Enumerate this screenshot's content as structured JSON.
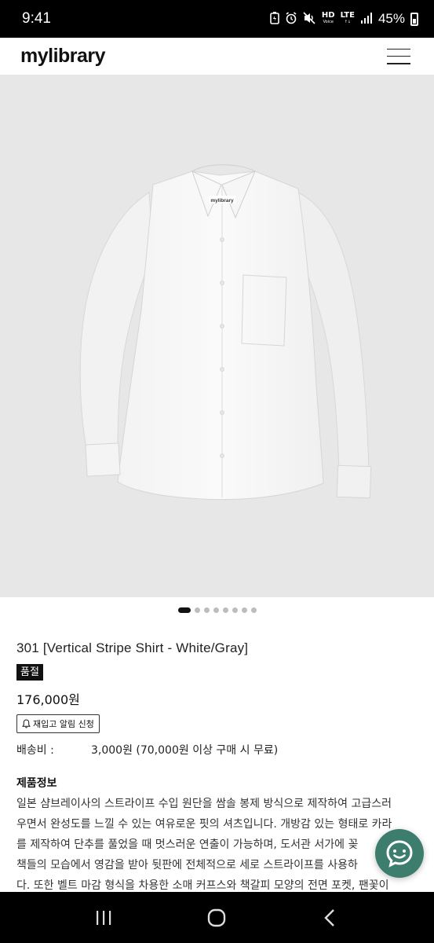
{
  "status_bar": {
    "time": "9:41",
    "hd_label": "HD",
    "hd_sub": "Voice",
    "lte_label": "LTE",
    "battery": "45%",
    "icons": [
      "battery-saver-icon",
      "alarm-icon",
      "mute-icon",
      "hd-voice-icon",
      "lte-icon",
      "signal-icon",
      "battery-icon"
    ]
  },
  "header": {
    "brand": "mylibrary",
    "menu_icon": "hamburger-menu-icon"
  },
  "gallery": {
    "image_label": "mylibrary",
    "slide_count": 8,
    "active_index": 0
  },
  "product": {
    "title": "301 [Vertical Stripe Shirt - White/Gray]",
    "status_badge": "품절",
    "price": "176,000원",
    "restock_button": "재입고 알림 신청",
    "shipping_label": "배송비 :",
    "shipping_value": "3,000원 (70,000원 이상 구매 시 무료)",
    "info_title": "제품정보",
    "description_lines": [
      "일본 샴브레이사의 스트라이프 수입 원단을 쌈솔 봉제 방식으로 제작하여 고급스러",
      "우면서 완성도를 느낄 수 있는 여유로운 핏의 셔츠입니다. 개방감 있는 형태로 카라",
      "를 제작하여 단추를 풀었을 때 멋스러운 연출이 가능하며, 도서관 서가에 꽂",
      "책들의 모습에서 영감을 받아 뒷판에 전체적으로 세로 스트라이프를 사용하",
      "다. 또한 벨트 마감 형식을 차용한 소매 커프스와 책갈피 모양의 전면 포켓, 팬꽃이"
    ]
  },
  "chat_button": {
    "icon": "chat-bubble-icon"
  },
  "nav_bar": {
    "icons": [
      "recent-apps-icon",
      "home-icon",
      "back-icon"
    ]
  }
}
